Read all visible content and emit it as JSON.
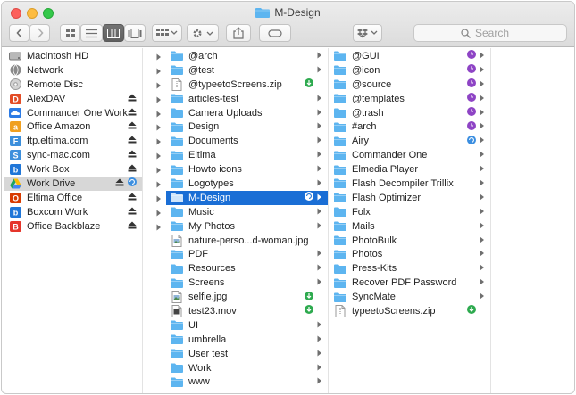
{
  "window": {
    "title": "M-Design"
  },
  "toolbar": {
    "search_placeholder": "Search"
  },
  "sidebar": {
    "items": [
      {
        "label": "Macintosh HD",
        "icon": "hard-drive-icon",
        "color": "#8e8e8e",
        "eject": false,
        "chevron": true
      },
      {
        "label": "Network",
        "icon": "globe-icon",
        "color": "#7a7a7a",
        "eject": false,
        "chevron": true
      },
      {
        "label": "Remote Disc",
        "icon": "disc-icon",
        "color": "#a0a0a0",
        "eject": false,
        "chevron": true
      },
      {
        "label": "AlexDAV",
        "icon": "dav-icon",
        "color": "#e34c26",
        "eject": true,
        "chevron": true
      },
      {
        "label": "Commander One Work",
        "icon": "cloud-icon",
        "color": "#2c7be5",
        "eject": true,
        "chevron": true
      },
      {
        "label": "Office Amazon",
        "icon": "amazon-icon",
        "color": "#f0a020",
        "eject": true,
        "chevron": true
      },
      {
        "label": "ftp.eltima.com",
        "icon": "ftp-icon",
        "color": "#3c8fdc",
        "eject": true,
        "chevron": true
      },
      {
        "label": "sync-mac.com",
        "icon": "sync-icon",
        "color": "#3c8fdc",
        "eject": true,
        "chevron": true
      },
      {
        "label": "Work Box",
        "icon": "box-icon",
        "color": "#1f76d8",
        "eject": true,
        "chevron": true
      },
      {
        "label": "Work Drive",
        "icon": "google-drive-icon",
        "color": "#31a354",
        "eject": true,
        "chevron": true,
        "selected": "gray",
        "sync": true
      },
      {
        "label": "Eltima Office",
        "icon": "office-icon",
        "color": "#d83b01",
        "eject": true,
        "chevron": true
      },
      {
        "label": "Boxcom Work",
        "icon": "box-icon",
        "color": "#1f76d8",
        "eject": true,
        "chevron": true
      },
      {
        "label": "Office Backblaze",
        "icon": "backblaze-icon",
        "color": "#e5352b",
        "eject": true,
        "chevron": true
      }
    ]
  },
  "column2": {
    "items": [
      {
        "label": "@arch",
        "type": "folder",
        "chevron": true
      },
      {
        "label": "@test",
        "type": "folder",
        "chevron": true
      },
      {
        "label": "@typeetoScreens.zip",
        "type": "file",
        "status": "download"
      },
      {
        "label": "articles-test",
        "type": "folder",
        "chevron": true
      },
      {
        "label": "Camera Uploads",
        "type": "folder",
        "chevron": true
      },
      {
        "label": "Design",
        "type": "folder",
        "chevron": true
      },
      {
        "label": "Documents",
        "type": "folder",
        "chevron": true
      },
      {
        "label": "Eltima",
        "type": "folder",
        "chevron": true
      },
      {
        "label": "Howto icons",
        "type": "folder",
        "chevron": true
      },
      {
        "label": "Logotypes",
        "type": "folder",
        "chevron": true
      },
      {
        "label": "M-Design",
        "type": "folder",
        "chevron": true,
        "selected": "blue",
        "status": "sync"
      },
      {
        "label": "Music",
        "type": "folder",
        "chevron": true
      },
      {
        "label": "My Photos",
        "type": "folder",
        "chevron": true
      },
      {
        "label": "nature-perso...d-woman.jpg",
        "type": "image"
      },
      {
        "label": "PDF",
        "type": "folder",
        "chevron": true
      },
      {
        "label": "Resources",
        "type": "folder",
        "chevron": true
      },
      {
        "label": "Screens",
        "type": "folder",
        "chevron": true
      },
      {
        "label": "selfie.jpg",
        "type": "image",
        "status": "download"
      },
      {
        "label": "test23.mov",
        "type": "movie",
        "status": "download"
      },
      {
        "label": "UI",
        "type": "folder",
        "chevron": true
      },
      {
        "label": "umbrella",
        "type": "folder",
        "chevron": true
      },
      {
        "label": "User test",
        "type": "folder",
        "chevron": true
      },
      {
        "label": "Work",
        "type": "folder",
        "chevron": true
      },
      {
        "label": "www",
        "type": "folder",
        "chevron": true
      }
    ]
  },
  "column3": {
    "items": [
      {
        "label": "@GUI",
        "type": "folder",
        "chevron": true,
        "status": "clock"
      },
      {
        "label": "@icon",
        "type": "folder",
        "chevron": true,
        "status": "clock"
      },
      {
        "label": "@source",
        "type": "folder",
        "chevron": true,
        "status": "clock"
      },
      {
        "label": "@templates",
        "type": "folder",
        "chevron": true,
        "status": "clock"
      },
      {
        "label": "@trash",
        "type": "folder",
        "chevron": true,
        "status": "clock"
      },
      {
        "label": "#arch",
        "type": "folder",
        "chevron": true,
        "status": "clock"
      },
      {
        "label": "Airy",
        "type": "folder",
        "chevron": true,
        "status": "sync"
      },
      {
        "label": "Commander One",
        "type": "folder",
        "chevron": true
      },
      {
        "label": "Elmedia Player",
        "type": "folder",
        "chevron": true
      },
      {
        "label": "Flash Decompiler Trillix",
        "type": "folder",
        "chevron": true
      },
      {
        "label": "Flash Optimizer",
        "type": "folder",
        "chevron": true
      },
      {
        "label": "Folx",
        "type": "folder",
        "chevron": true
      },
      {
        "label": "Mails",
        "type": "folder",
        "chevron": true
      },
      {
        "label": "PhotoBulk",
        "type": "folder",
        "chevron": true
      },
      {
        "label": "Photos",
        "type": "folder",
        "chevron": true
      },
      {
        "label": "Press-Kits",
        "type": "folder",
        "chevron": true
      },
      {
        "label": "Recover PDF Password",
        "type": "folder",
        "chevron": true
      },
      {
        "label": "SyncMate",
        "type": "folder",
        "chevron": true
      },
      {
        "label": "typeetoScreens.zip",
        "type": "file",
        "status": "download"
      }
    ]
  },
  "colors": {
    "folder": "#5db5f0",
    "selection": "#1a6ed5",
    "download": "#2eaa4f",
    "clock": "#8e44c5",
    "sync": "#3b8ee0"
  }
}
